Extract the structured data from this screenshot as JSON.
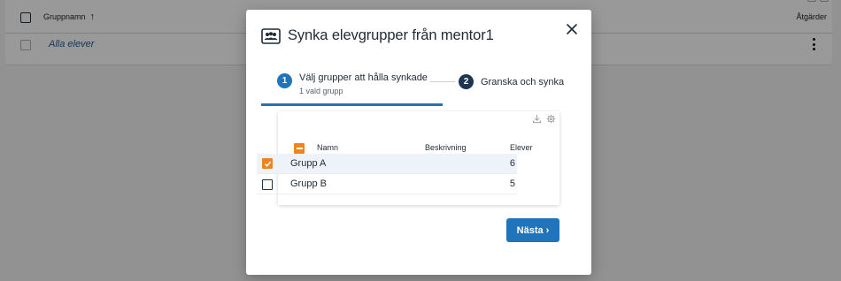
{
  "background": {
    "table_header": {
      "group_name_label": "Gruppnamn",
      "actions_label": "Åtgärder"
    },
    "rows": [
      {
        "name": "Alla elever"
      }
    ]
  },
  "modal": {
    "title": "Synka elevgrupper från mentor1",
    "steps": [
      {
        "number": "1",
        "label": "Välj grupper att hålla synkade",
        "sublabel": "1 vald grupp",
        "active": true
      },
      {
        "number": "2",
        "label": "Granska och synka",
        "active": false
      }
    ],
    "table": {
      "headers": {
        "name": "Namn",
        "description": "Beskrivning",
        "students": "Elever"
      },
      "rows": [
        {
          "name": "Grupp A",
          "description": "",
          "students": "6",
          "checked": true
        },
        {
          "name": "Grupp B",
          "description": "",
          "students": "5",
          "checked": false
        }
      ]
    },
    "next_label": "Nästa ›",
    "colors": {
      "primary": "#1f74bb",
      "checkbox_checked": "#ee8523",
      "step_inactive": "#1e3552"
    }
  }
}
